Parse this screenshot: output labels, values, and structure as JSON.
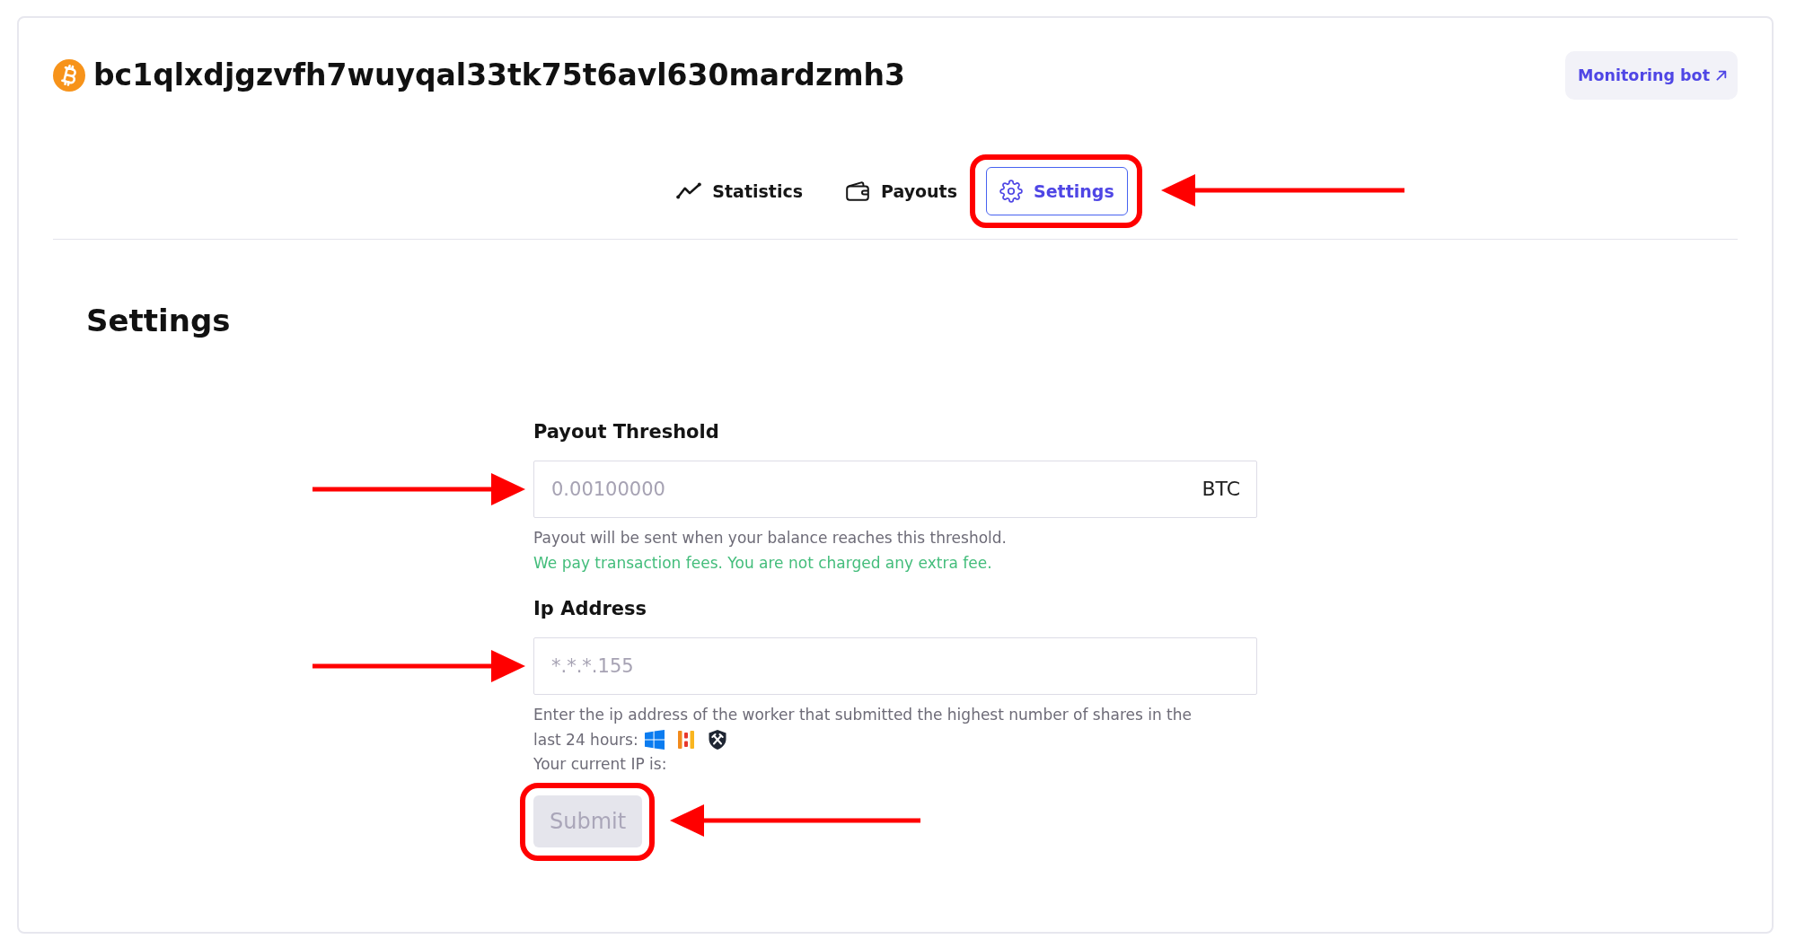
{
  "header": {
    "address": "bc1qlxdjgzvfh7wuyqal33tk75t6avl630mardzmh3",
    "link_button": {
      "label": "Monitoring bot"
    }
  },
  "tabs": [
    {
      "label": "Statistics",
      "selected": false,
      "highlighted": false
    },
    {
      "label": "Payouts",
      "selected": false,
      "highlighted": false
    },
    {
      "label": "Settings",
      "selected": true,
      "highlighted": true
    }
  ],
  "section_title": "Settings",
  "fields": [
    {
      "label": "Payout Threshold",
      "placeholder": "0.00100000",
      "suffix": "BTC",
      "pointed": true,
      "hints": [
        {
          "kind": "note",
          "text": "Payout will be sent when your balance reaches this threshold."
        },
        {
          "kind": "success",
          "text": "We pay transaction fees. You are not charged any extra fee."
        }
      ]
    },
    {
      "label": "Ip Address",
      "placeholder": "*.*.*.155",
      "pointed": true,
      "hints": [
        {
          "kind": "note",
          "text": "Enter the ip address of the worker that submitted the highest number of shares in the"
        },
        {
          "kind": "note_icons",
          "text": "last 24 hours:"
        },
        {
          "kind": "note",
          "text": "Your current IP is:"
        }
      ]
    }
  ],
  "submit": {
    "label": "Submit",
    "disabled": true,
    "highlighted": true
  }
}
